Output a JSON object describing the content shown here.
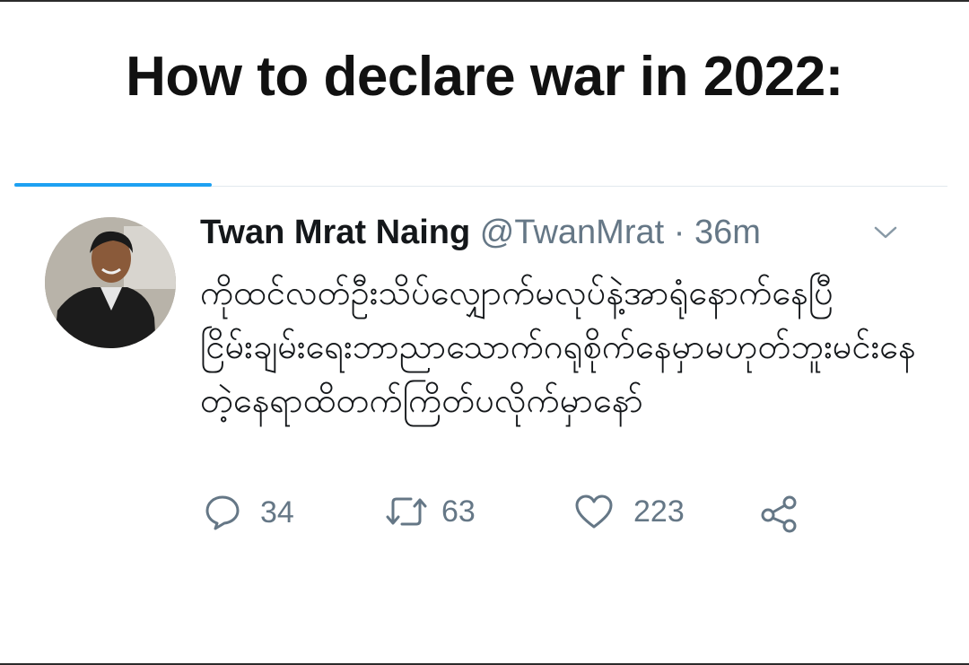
{
  "meme": {
    "title": "How to declare war in 2022:"
  },
  "tweet": {
    "author_name": "Twan Mrat Naing",
    "handle": "@TwanMrat",
    "separator": " · ",
    "time": "36m",
    "text": "ကိုထင်လတ်ဦးသိပ်လျှောက်မလုပ်နဲ့အာရုံနောက်နေပြီငြိမ်းချမ်းရေးဘာညာသောက်ဂရုစိုက်နေမှာမဟုတ်ဘူးမင်းနေတဲ့နေရာထိတက်ကြိတ်ပလိုက်မှာနော်",
    "actions": {
      "reply": {
        "icon": "reply-icon",
        "count": "34"
      },
      "retweet": {
        "icon": "retweet-icon",
        "count": "63"
      },
      "like": {
        "icon": "heart-icon",
        "count": "223"
      },
      "share": {
        "icon": "share-icon"
      }
    }
  },
  "colors": {
    "accent": "#1da1f2",
    "muted": "#657786",
    "text": "#14171a"
  }
}
